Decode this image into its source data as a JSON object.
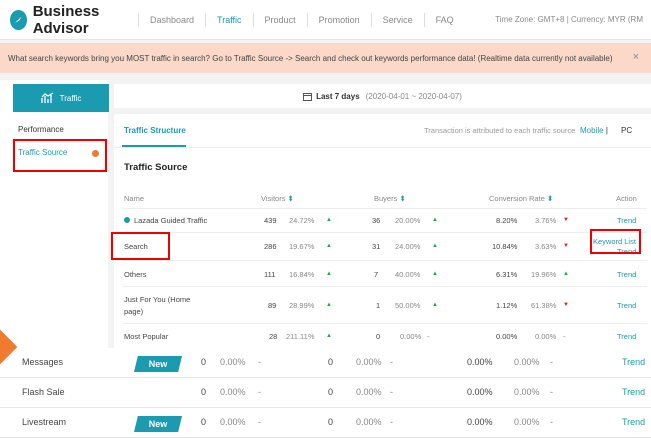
{
  "header": {
    "app_title": "Business Advisor",
    "nav": [
      "Dashboard",
      "Traffic",
      "Product",
      "Promotion",
      "Service",
      "FAQ"
    ],
    "active_nav": "Traffic",
    "timezone": "Time Zone: GMT+8 | Currency: MYR (RM"
  },
  "banner": {
    "text": "What search keywords bring you MOST traffic in search? Go to Traffic Source -> Search and check out keywords performance data! (Realtime data currently not available)",
    "close": "×"
  },
  "sidebar": {
    "title": "Traffic",
    "items": [
      "Performance",
      "Traffic Source"
    ]
  },
  "date": {
    "label": "Last 7 days",
    "range": "(2020-04-01 ~ 2020-04-07)"
  },
  "tabs": {
    "active": "Traffic Structure",
    "note": "Transaction is attributed to each traffic source",
    "mobile": "Mobile",
    "sep": "|",
    "pc": "PC"
  },
  "section_title": "Traffic Source",
  "table": {
    "headers": {
      "name": "Name",
      "visitors": "Visitors",
      "buyers": "Buyers",
      "conv": "Conversion Rate",
      "action": "Action"
    },
    "rows": [
      {
        "name": "Lazada Guided Traffic",
        "visitors": "439",
        "v_pct": "24.72%",
        "v_dir": "up",
        "buyers": "36",
        "b_pct": "20.00%",
        "b_dir": "up",
        "conv": "8.20%",
        "c_pct": "3.76%",
        "c_dir": "down",
        "action": "Trend"
      },
      {
        "name": "Search",
        "visitors": "286",
        "v_pct": "19.67%",
        "v_dir": "up",
        "buyers": "31",
        "b_pct": "24.00%",
        "b_dir": "up",
        "conv": "10.84%",
        "c_pct": "3.63%",
        "c_dir": "down",
        "action": "Keyword List",
        "action2": "Trend"
      },
      {
        "name": "Others",
        "visitors": "111",
        "v_pct": "16.84%",
        "v_dir": "up",
        "buyers": "7",
        "b_pct": "40.00%",
        "b_dir": "up",
        "conv": "6.31%",
        "c_pct": "19.96%",
        "c_dir": "up",
        "action": "Trend"
      },
      {
        "name": "Just For You (Home",
        "name2": "page)",
        "visitors": "89",
        "v_pct": "28.99%",
        "v_dir": "up",
        "buyers": "1",
        "b_pct": "50.00%",
        "b_dir": "up",
        "conv": "1.12%",
        "c_pct": "61.38%",
        "c_dir": "down",
        "action": "Trend"
      },
      {
        "name": "Most Popular",
        "visitors": "28",
        "v_pct": "211.11%",
        "v_dir": "up",
        "buyers": "0",
        "b_pct": "0.00%",
        "b_dir": "none",
        "conv": "0.00%",
        "c_pct": "0.00%",
        "c_dir": "none",
        "action": "Trend"
      }
    ]
  },
  "overlay_rows": [
    {
      "name": "Messages",
      "badge": "New",
      "visitors": "0",
      "v_pct": "0.00%",
      "buyers": "0",
      "b_pct": "0.00%",
      "conv": "0.00%",
      "c_pct": "0.00%",
      "dash": "-",
      "action": "Trend"
    },
    {
      "name": "Flash Sale",
      "badge": "",
      "visitors": "0",
      "v_pct": "0.00%",
      "buyers": "0",
      "b_pct": "0.00%",
      "conv": "0.00%",
      "c_pct": "0.00%",
      "dash": "-",
      "action": "Trend"
    },
    {
      "name": "Livestream",
      "badge": "New",
      "visitors": "0",
      "v_pct": "0.00%",
      "buyers": "0",
      "b_pct": "0.00%",
      "conv": "0.00%",
      "c_pct": "0.00%",
      "dash": "-",
      "action": "Trend"
    }
  ],
  "colors": {
    "accent": "#1a9bb0",
    "up": "#1fa84a",
    "down": "#e02020",
    "highlight": "#e00000",
    "banner": "#fbd8c7"
  }
}
